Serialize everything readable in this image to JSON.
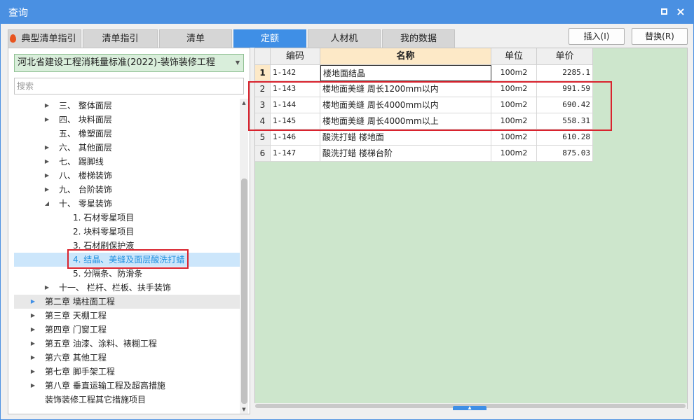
{
  "window": {
    "title": "查询",
    "maximize_icon": "maximize-icon",
    "close_symbol": "×"
  },
  "tabs": [
    {
      "label": "典型清单指引",
      "active": false,
      "icon": "fire-icon"
    },
    {
      "label": "清单指引",
      "active": false
    },
    {
      "label": "清单",
      "active": false
    },
    {
      "label": "定额",
      "active": true
    },
    {
      "label": "人材机",
      "active": false
    },
    {
      "label": "我的数据",
      "active": false
    }
  ],
  "actions": {
    "insert_label": "插入(I)",
    "replace_label": "替换(R)"
  },
  "library": {
    "selected": "河北省建设工程消耗量标准(2022)-装饰装修工程"
  },
  "search": {
    "placeholder": "搜索",
    "value": ""
  },
  "tree": {
    "items": [
      {
        "label": "三、 整体面层",
        "expandable": true,
        "expanded": false
      },
      {
        "label": "四、 块料面层",
        "expandable": true,
        "expanded": false
      },
      {
        "label": "五、 橡塑面层",
        "expandable": false
      },
      {
        "label": "六、 其他面层",
        "expandable": true,
        "expanded": false
      },
      {
        "label": "七、 踢脚线",
        "expandable": true,
        "expanded": false
      },
      {
        "label": "八、 楼梯装饰",
        "expandable": true,
        "expanded": false
      },
      {
        "label": "九、 台阶装饰",
        "expandable": true,
        "expanded": false
      },
      {
        "label": "十、 零星装饰",
        "expandable": true,
        "expanded": true
      },
      {
        "label": "1. 石材零星项目",
        "expandable": false
      },
      {
        "label": "2. 块料零星项目",
        "expandable": false
      },
      {
        "label": "3. 石材刷保护液",
        "expandable": false
      },
      {
        "label": "4. 结晶、美缝及面层酸洗打蜡",
        "expandable": false,
        "selected": true
      },
      {
        "label": "5. 分隔条、防滑条",
        "expandable": false
      },
      {
        "label": "十一、 栏杆、栏板、扶手装饰",
        "expandable": true,
        "expanded": false
      },
      {
        "label": "第二章 墙柱面工程",
        "expandable": true,
        "expanded": false
      },
      {
        "label": "第三章 天棚工程",
        "expandable": true,
        "expanded": false
      },
      {
        "label": "第四章 门窗工程",
        "expandable": true,
        "expanded": false
      },
      {
        "label": "第五章 油漆、涂料、裱糊工程",
        "expandable": true,
        "expanded": false
      },
      {
        "label": "第六章 其他工程",
        "expandable": true,
        "expanded": false
      },
      {
        "label": "第七章 脚手架工程",
        "expandable": true,
        "expanded": false
      },
      {
        "label": "第八章 垂直运输工程及超高措施",
        "expandable": true,
        "expanded": false
      },
      {
        "label": "装饰装修工程其它措施项目",
        "expandable": false
      }
    ]
  },
  "grid": {
    "columns": {
      "code": "编码",
      "name": "名称",
      "unit": "单位",
      "price": "单价"
    },
    "rows": [
      {
        "num": "1",
        "code": "1-142",
        "name": "楼地面结晶",
        "unit": "100m2",
        "price": "2285.1"
      },
      {
        "num": "2",
        "code": "1-143",
        "name": "楼地面美缝 周长1200mm以内",
        "unit": "100m2",
        "price": "991.59"
      },
      {
        "num": "3",
        "code": "1-144",
        "name": "楼地面美缝 周长4000mm以内",
        "unit": "100m2",
        "price": "690.42"
      },
      {
        "num": "4",
        "code": "1-145",
        "name": "楼地面美缝 周长4000mm以上",
        "unit": "100m2",
        "price": "558.31"
      },
      {
        "num": "5",
        "code": "1-146",
        "name": "酸洗打蜡 楼地面",
        "unit": "100m2",
        "price": "610.28"
      },
      {
        "num": "6",
        "code": "1-147",
        "name": "酸洗打蜡 楼梯台阶",
        "unit": "100m2",
        "price": "875.03"
      }
    ]
  },
  "colors": {
    "titlebar": "#4a90e2",
    "active_tab": "#3f8fe6",
    "grid_background": "#cde6cc",
    "name_header": "#fde9c7",
    "selected_tree": "#cce6fb",
    "highlight_box": "#d9232e"
  }
}
